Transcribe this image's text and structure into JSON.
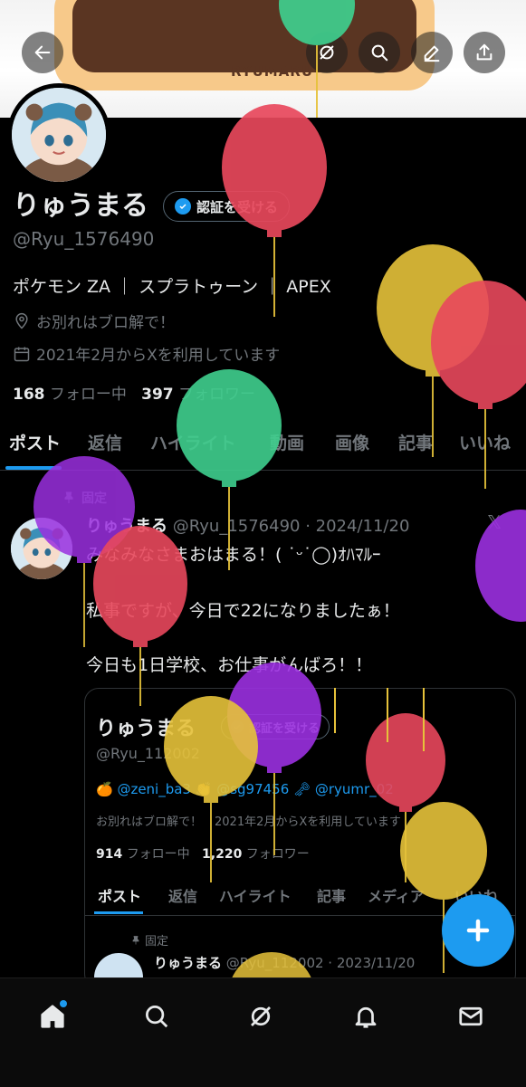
{
  "profile": {
    "display_name": "りゅうまる",
    "verify_label": "認証を受ける",
    "handle": "@Ryu_1576490",
    "bio": "ポケモン ZA ｜ スプラトゥーン ｜ APEX",
    "location": "お別れはブロ解で！",
    "joined": "2021年2月からXを利用しています",
    "following_count": "168",
    "following_label": "フォロー中",
    "followers_count": "397",
    "followers_label": "フォロワー"
  },
  "banner": {
    "logo_text": "RYUMARU"
  },
  "tabs": [
    "ポスト",
    "返信",
    "ハイライト",
    "動画",
    "画像",
    "記事",
    "いいね"
  ],
  "pinned_post": {
    "pinned_label": "固定",
    "author": "りゅうまる",
    "handle_date": "@Ryu_1576490 · 2024/11/20",
    "lines": [
      "みなみなさまおはまる！( ˙ᵕ˙◯)ｵﾊﾏﾙｰ",
      "私事ですが、今日で22になりましたぁ！",
      "今日も1日学校、お仕事がんばろ！！"
    ]
  },
  "embedded_profile": {
    "display_name": "りゅうまる",
    "verify_label": "認証を受ける",
    "handle": "@Ryu_112002",
    "links": "🍊 @zeni_ba3 👏 @sg97456 🗝 @ryumr_02",
    "location": "お別れはブロ解で！",
    "joined": "2021年2月からXを利用しています",
    "following_count": "914",
    "following_label": "フォロー中",
    "followers_count": "1,220",
    "followers_label": "フォロワー",
    "tabs": [
      "ポスト",
      "返信",
      "ハイライト",
      "記事",
      "メディア",
      "いいね"
    ],
    "pinned_label": "固定",
    "post_author": "りゅうまる",
    "post_handle_date": "@Ryu_112002 · 2023/11/20"
  },
  "icons": [
    "back-arrow-icon",
    "grok-icon",
    "search-icon",
    "edit-icon",
    "share-icon",
    "verified-badge-icon",
    "location-icon",
    "calendar-icon",
    "pin-icon",
    "x-logo-icon",
    "plus-icon",
    "home-icon",
    "explore-icon",
    "grok-nav-icon",
    "notifications-icon",
    "messages-icon"
  ],
  "colors": {
    "accent": "#1d9bf0",
    "background": "#000000",
    "text": "#e7e9ea",
    "muted": "#71767b"
  },
  "balloon_colors": {
    "red": "#e8485c",
    "green": "#3fcf8e",
    "yellow": "#e6c23a",
    "purple": "#9b30e0"
  }
}
